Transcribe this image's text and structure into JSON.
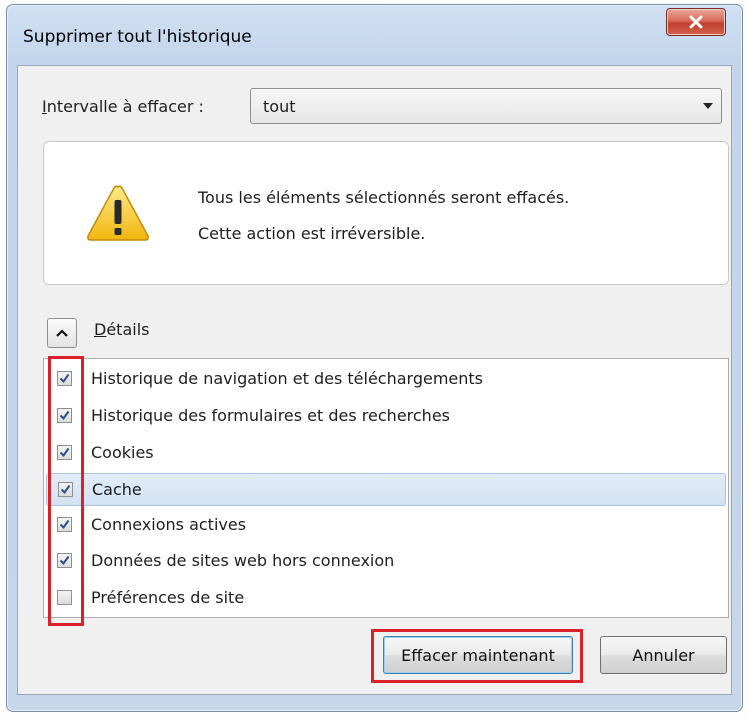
{
  "window": {
    "title": "Supprimer tout l'historique",
    "close_icon": "close-x-icon"
  },
  "interval": {
    "label_accesskey": "I",
    "label_rest": "ntervalle à effacer :",
    "value": "tout"
  },
  "warning": {
    "icon": "warning-triangle-icon",
    "line1": "Tous les éléments sélectionnés seront effacés.",
    "line2": "Cette action est irréversible."
  },
  "details": {
    "label_accesskey": "D",
    "label_rest": "étails",
    "expanded": true
  },
  "items": [
    {
      "label": "Historique de navigation et des téléchargements",
      "checked": true
    },
    {
      "label": "Historique des formulaires et des recherches",
      "checked": true
    },
    {
      "label": "Cookies",
      "checked": true
    },
    {
      "label": "Cache",
      "checked": true
    },
    {
      "label": "Connexions actives",
      "checked": true
    },
    {
      "label": "Données de sites web hors connexion",
      "checked": true
    },
    {
      "label": "Préférences de site",
      "checked": false
    }
  ],
  "selected_item": "Cache",
  "buttons": {
    "clear_now": "Effacer maintenant",
    "cancel": "Annuler"
  },
  "colors": {
    "highlight_box": "#d9202b",
    "selection": "#d2e2f4",
    "close_button": "#c2402e",
    "warning_yellow": "#f2c417"
  }
}
